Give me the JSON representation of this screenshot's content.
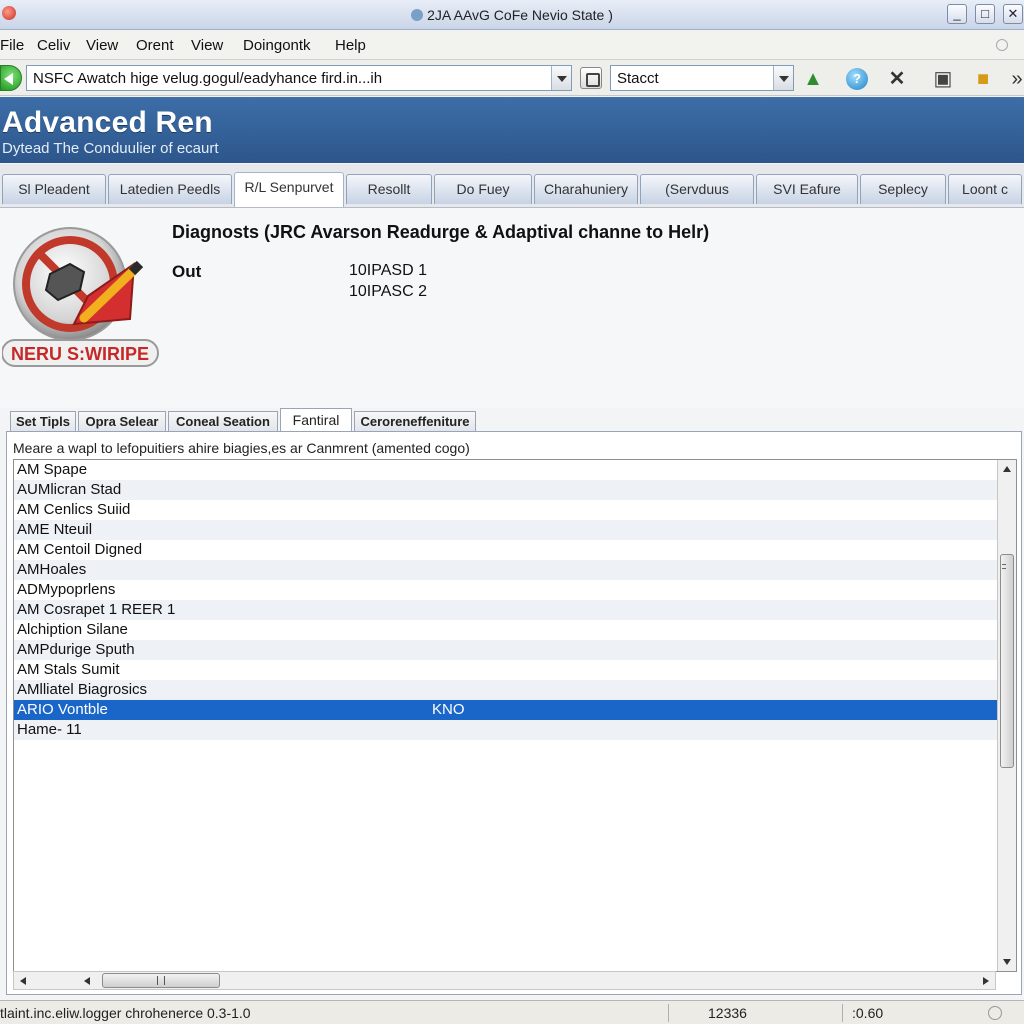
{
  "window": {
    "title": "2JA AAvG CoFe Nevio State )",
    "controls": [
      "_",
      "□",
      "✕"
    ]
  },
  "menu": [
    "File",
    "Celiv",
    "View",
    "Orent",
    "View",
    "Doingontk",
    "Help"
  ],
  "toolbar": {
    "address": "NSFC Awatch  hige velug.gogul/eadyhance fird.in...ih",
    "search": "Stacct",
    "icons": [
      "back-arrow-icon",
      "go-icon",
      "warning-icon",
      "globe-icon",
      "stop-icon",
      "print-icon",
      "doc-icon",
      "more-icon"
    ]
  },
  "banner": {
    "title": "Advanced Ren",
    "subtitle": "Dytead The Conduulier of ecaurt"
  },
  "nav_tabs": [
    "Sl Pleadent",
    "Latedien Peedls",
    "R/L Senpurvet",
    "Resollt",
    "Do Fuey",
    "Charahuniery",
    "(Servduus",
    "SVI Eafure",
    "Seplecy",
    "Loont c"
  ],
  "nav_active_index": 2,
  "content": {
    "logo_text": "NERU S:WIRIPE",
    "title": "Diagnosts (JRC Avarson Readurge & Adaptival channe to Helr)",
    "label": "Out",
    "values": [
      "10IPASD 1",
      "10IPASC 2"
    ]
  },
  "sub_tabs": [
    "Set Tipls",
    "Opra Selear",
    "Coneal Seation",
    "Fantiral",
    "Ceroreneffeniture"
  ],
  "sub_active_index": 3,
  "panel": {
    "description": "Meare a wapl to lefopuitiers ahire biagies,es ar Canmrent (amented cogo)",
    "rows": [
      {
        "label": "AM Spape",
        "value": ""
      },
      {
        "label": "AUMlicran Stad",
        "value": ""
      },
      {
        "label": "AM  Cenlics Suiid",
        "value": ""
      },
      {
        "label": "AME Nteuil",
        "value": ""
      },
      {
        "label": "AM Centoil Digned",
        "value": ""
      },
      {
        "label": "AMHoales",
        "value": ""
      },
      {
        "label": "ADMypoprlens",
        "value": ""
      },
      {
        "label": "AM Cosrapet 1 REER 1",
        "value": ""
      },
      {
        "label": "Alchiption Silane",
        "value": ""
      },
      {
        "label": "AMPdurige Sputh",
        "value": ""
      },
      {
        "label": "AM Stals Sumit",
        "value": ""
      },
      {
        "label": "AMlliatel Biagrosics",
        "value": ""
      },
      {
        "label": "ARIO Vontble",
        "value": "KNO"
      },
      {
        "label": "Hame- 11",
        "value": ""
      }
    ],
    "selected_row_index": 12
  },
  "status": {
    "left": "tlaint.inc.eliw.logger chrohenerce 0.3-1.0",
    "middle": "12336",
    "right": ":0.60"
  },
  "colors": {
    "banner": "#2f5c94",
    "selection": "#1a66c8"
  }
}
